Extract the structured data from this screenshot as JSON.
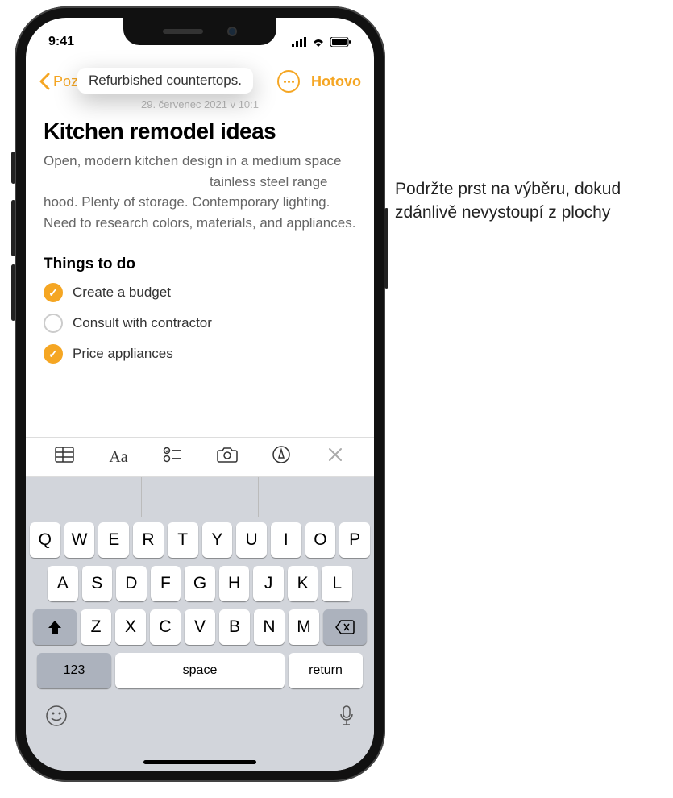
{
  "status": {
    "time": "9:41"
  },
  "nav": {
    "back_label": "Poznámky",
    "done_label": "Hotovo"
  },
  "note": {
    "timestamp": "29. červenec 2021 v 10:1",
    "title": "Kitchen remodel ideas",
    "body_before": "Open, modern kitchen design in a medium space",
    "body_float": "Refurbished countertops.",
    "body_after": "tainless steel range hood. Plenty of storage. Contemporary lighting. Need to research colors, materials, and appliances.",
    "section_title": "Things to do",
    "todos": [
      {
        "label": "Create a budget",
        "checked": true
      },
      {
        "label": "Consult with contractor",
        "checked": false
      },
      {
        "label": "Price appliances",
        "checked": true
      }
    ]
  },
  "format_bar": {
    "text_label": "Aa"
  },
  "keyboard": {
    "row1": [
      "Q",
      "W",
      "E",
      "R",
      "T",
      "Y",
      "U",
      "I",
      "O",
      "P"
    ],
    "row2": [
      "A",
      "S",
      "D",
      "F",
      "G",
      "H",
      "J",
      "K",
      "L"
    ],
    "row3": [
      "Z",
      "X",
      "C",
      "V",
      "B",
      "N",
      "M"
    ],
    "k123": "123",
    "space": "space",
    "return": "return"
  },
  "callout": {
    "text": "Podržte prst na výběru, dokud zdánlivě nevystoupí z plochy"
  }
}
